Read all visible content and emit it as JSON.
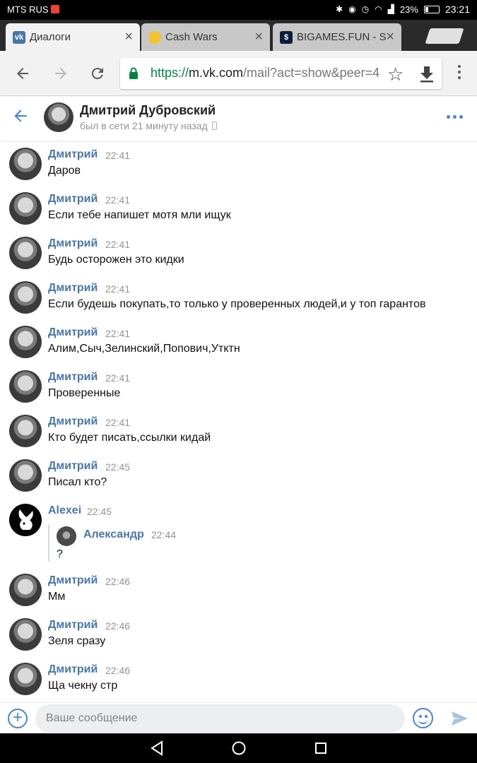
{
  "status_bar": {
    "carrier": "MTS RUS",
    "battery": "23%",
    "time": "23:21"
  },
  "tabs": [
    {
      "title": "Диалоги",
      "favicon": "vk-icon",
      "active": true
    },
    {
      "title": "Cash Wars",
      "favicon": "coin-icon",
      "active": false
    },
    {
      "title": "BIGAMES.FUN - S",
      "favicon": "dollar-icon",
      "active": false
    }
  ],
  "toolbar": {
    "url_scheme": "https://",
    "url_host": "m.vk.com",
    "url_path": "/mail?act=show&peer=4"
  },
  "chat": {
    "name": "Дмитрий Дубровский",
    "status": "был в сети 21 минуту назад"
  },
  "messages": [
    {
      "author": "Дмитрий",
      "time": "22:41",
      "text": "Даров"
    },
    {
      "author": "Дмитрий",
      "time": "22:41",
      "text": "Если тебе напишет мотя мли ищук"
    },
    {
      "author": "Дмитрий",
      "time": "22:41",
      "text": "Будь осторожен это кидки"
    },
    {
      "author": "Дмитрий",
      "time": "22:41",
      "text": "Если будешь покупать,то только у проверенных людей,и у топ гарантов"
    },
    {
      "author": "Дмитрий",
      "time": "22:41",
      "text": "Алим,Сыч,Зелинский,Попович,Утктн"
    },
    {
      "author": "Дмитрий",
      "time": "22:41",
      "text": "Проверенные"
    },
    {
      "author": "Дмитрий",
      "time": "22:41",
      "text": "Кто будет писать,ссылки кидай"
    },
    {
      "author": "Дмитрий",
      "time": "22:45",
      "text": "Писал кто?"
    },
    {
      "author": "Alexei",
      "time": "22:45",
      "forwarded": {
        "author": "Александр",
        "time": "22:44",
        "text": "?"
      }
    },
    {
      "author": "Дмитрий",
      "time": "22:46",
      "text": "Мм"
    },
    {
      "author": "Дмитрий",
      "time": "22:46",
      "text": "Зеля сразу"
    },
    {
      "author": "Дмитрий",
      "time": "22:46",
      "text": "Ща чекну стр"
    }
  ],
  "composer": {
    "placeholder": "Ваше сообщение"
  }
}
